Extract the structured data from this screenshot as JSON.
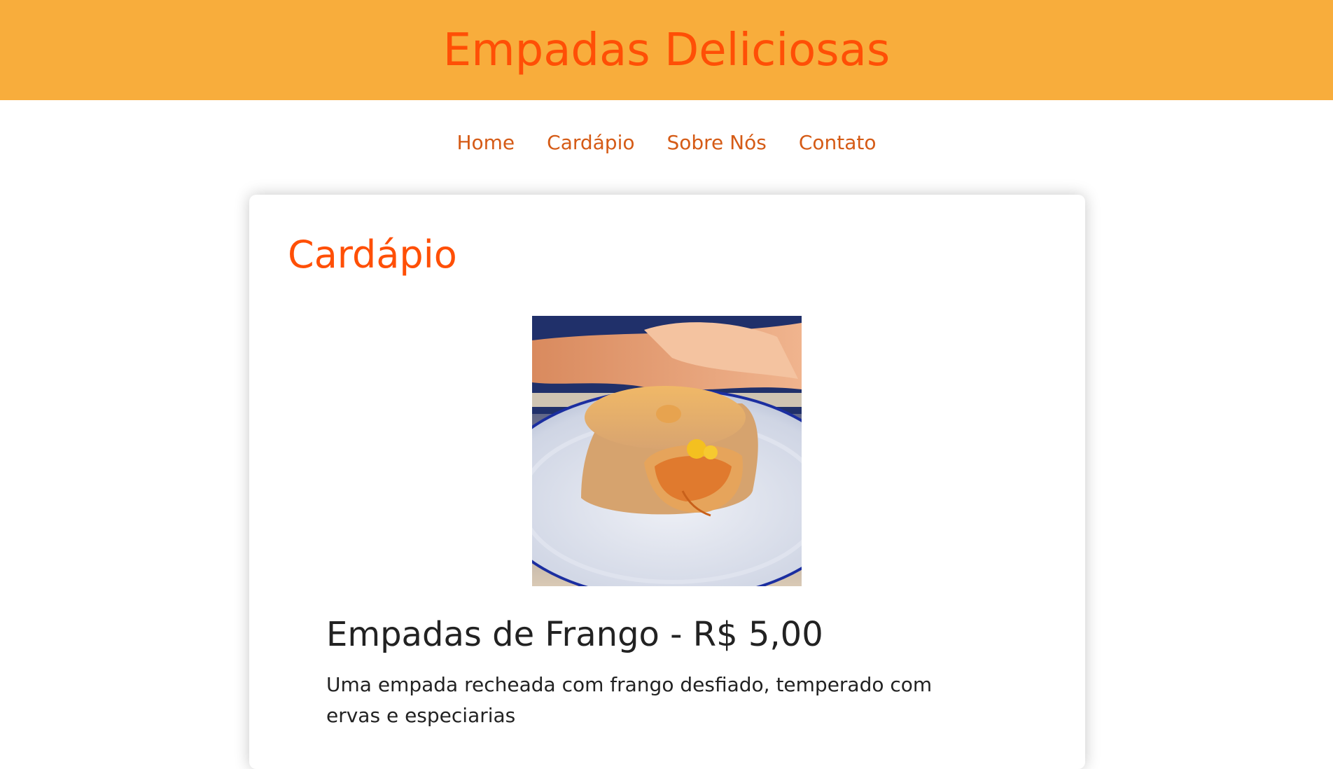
{
  "header": {
    "title": "Empadas Deliciosas"
  },
  "nav": {
    "items": [
      {
        "label": "Home"
      },
      {
        "label": "Cardápio"
      },
      {
        "label": "Sobre Nós"
      },
      {
        "label": "Contato"
      }
    ]
  },
  "menu": {
    "section_title": "Cardápio",
    "items": [
      {
        "name_price": "Empadas de Frango - R$ 5,00",
        "description": "Uma empada recheada com frango desfiado, temperado com ervas e especiarias"
      }
    ]
  },
  "colors": {
    "header_bg": "#f8ad3c",
    "accent": "#ff4f06",
    "nav_link": "#d55b16"
  }
}
